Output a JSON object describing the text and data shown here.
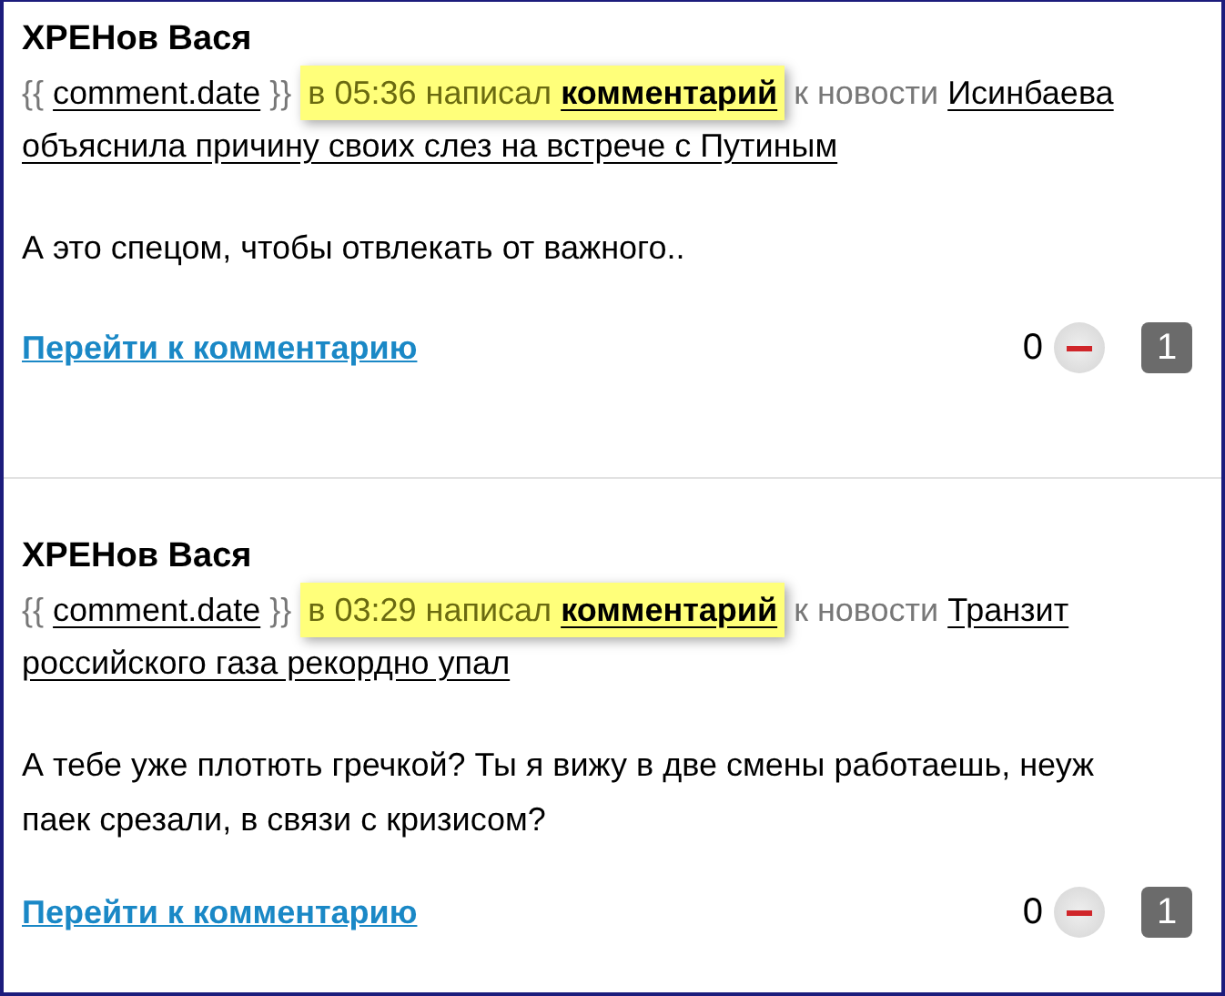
{
  "comments": [
    {
      "author": "ХРЕНов Вася",
      "open_brace": "{{",
      "date_link": "comment.date",
      "close_brace": "}}",
      "callout_text": "в 05:36 написал",
      "comment_link": "комментарий",
      "news_prefix": "к новости",
      "news_title_lines": [
        "Исинбаева",
        "объяснила причину своих слез на встрече с Путиным"
      ],
      "text_lines": [
        "А это спецом, чтобы отвлекать от важного.."
      ],
      "goto_link": "Перейти к комментарию",
      "score": "0",
      "count": "1"
    },
    {
      "author": "ХРЕНов Вася",
      "open_brace": "{{",
      "date_link": "comment.date",
      "close_brace": "}}",
      "callout_text": "в 03:29 написал",
      "comment_link": "комментарий",
      "news_prefix": "к новости",
      "news_title_lines": [
        "Транзит",
        "российского газа рекордно упал"
      ],
      "text_lines": [
        "А тебе уже плотють гречкой? Ты я вижу в две смены работаешь, неуж",
        "паек срезали, в связи с кризисом?"
      ],
      "goto_link": "Перейти к комментарию",
      "score": "0",
      "count": "1"
    }
  ]
}
